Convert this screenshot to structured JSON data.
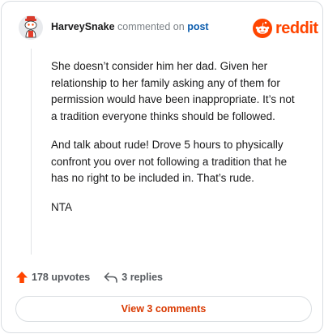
{
  "comment": {
    "username": "HarveySnake",
    "action_text": "commented on",
    "target_text": "post",
    "paragraphs": [
      "She doesn’t consider him her dad. Given her relationship to her family asking any of them for permission would have been inappropriate. It’s not a tradition everyone thinks should be followed.",
      "And talk about rude! Drove 5 hours to physically confront you over not following a tradition that he has no right to be included in. That’s rude.",
      "NTA"
    ],
    "upvotes_label": "178 upvotes",
    "replies_label": "3 replies",
    "view_comments_label": "View 3 comments"
  },
  "brand": {
    "name": "reddit",
    "color": "#ff4500"
  },
  "colors": {
    "link": "#0b5cad",
    "upvote": "#ff4500",
    "view_button_text": "#d93900"
  },
  "icons": [
    "snoo-avatar-icon",
    "reddit-logo-icon",
    "upvote-arrow-icon",
    "reply-arrow-icon"
  ]
}
